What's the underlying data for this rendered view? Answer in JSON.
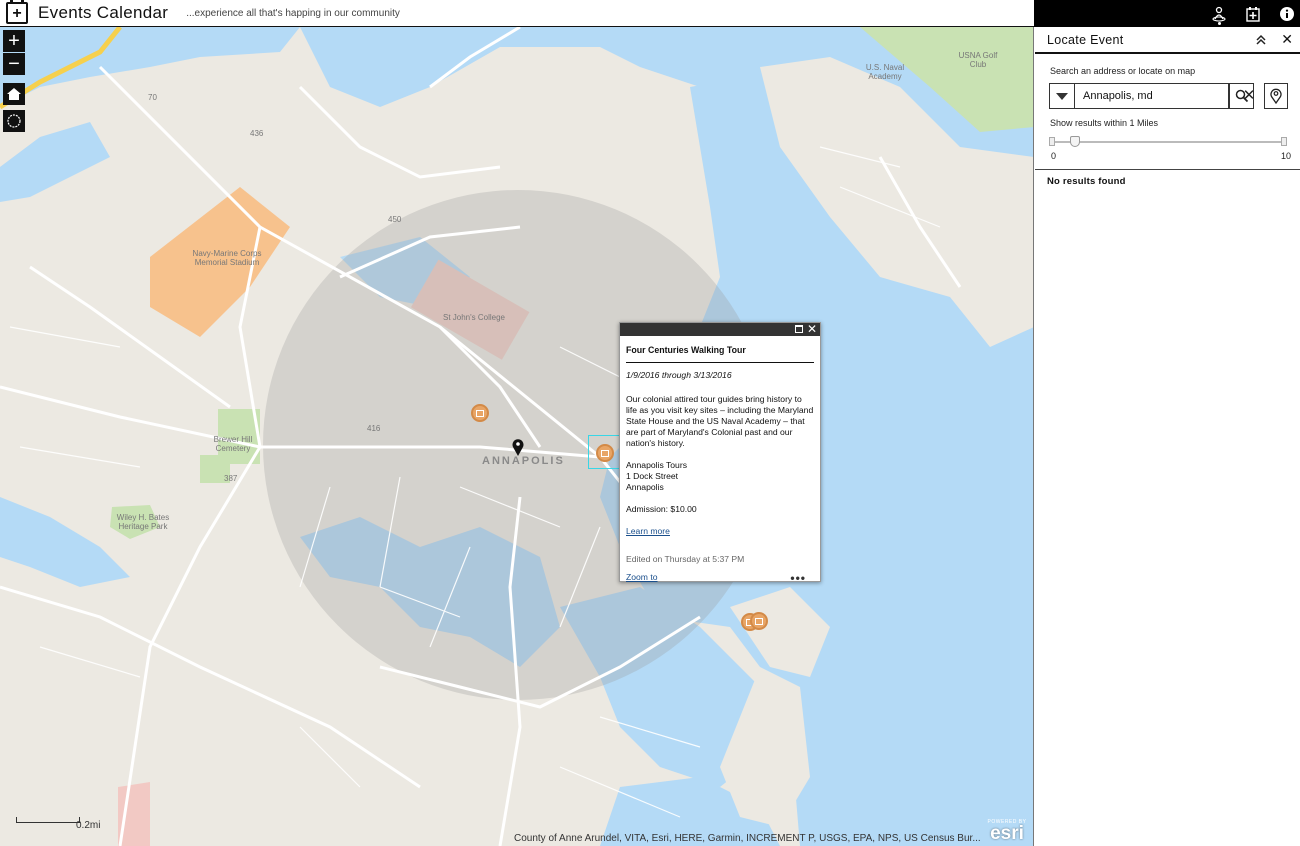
{
  "header": {
    "title": "Events Calendar",
    "subtitle": "...experience all that's happing in our community"
  },
  "toolbar": {
    "icons": [
      "locate-person-icon",
      "add-event-icon",
      "info-icon"
    ],
    "active": "locate-person-icon"
  },
  "map": {
    "labels": {
      "annapolis": "ANNAPOLIS",
      "st_johns": "St John's College",
      "stadium": "Navy-Marine Corps Memorial Stadium",
      "cemetery": "Brewer Hill Cemetery",
      "park": "Wiley H. Bates Heritage Park",
      "naval_academy": "U.S. Naval Academy",
      "golf": "USNA Golf Club",
      "route_70": "70",
      "route_450": "450",
      "route_436": "436",
      "route_387": "387",
      "route_416": "416"
    },
    "scale_label": "0.2mi",
    "attribution": "County of Anne Arundel, VITA, Esri, HERE, Garmin, INCREMENT P, USGS, EPA, NPS, US Census Bur...",
    "logo": {
      "powered": "POWERED BY",
      "word": "esri"
    },
    "colors": {
      "water": "#b4daf6",
      "land": "#ece9e2",
      "park": "#c9e2b3",
      "stadium": "#f7c28d",
      "buffer": "rgba(150,150,150,0.28)",
      "marker": "#e8a566"
    }
  },
  "popup": {
    "title": "Four Centuries Walking Tour",
    "dates": "1/9/2016 through 3/13/2016",
    "description": "Our colonial attired tour guides bring history to life as you visit key sites – including the Maryland State House and the US Naval Academy – that are part of Maryland's Colonial past and our nation's history.",
    "address": {
      "line1": "Annapolis Tours",
      "line2": "1 Dock Street",
      "line3": "Annapolis"
    },
    "admission": "Admission: $10.00",
    "learn_more": "Learn more",
    "edited": "Edited on Thursday at 5:37 PM",
    "zoom_to": "Zoom to",
    "menu": "•••"
  },
  "panel": {
    "title": "Locate Event",
    "search_label": "Search an address or locate on map",
    "search_value": "Annapolis, md",
    "range_label": "Show results within 1 Miles",
    "range_min": "0",
    "range_max": "10",
    "range_value": 1,
    "no_results": "No results found"
  }
}
